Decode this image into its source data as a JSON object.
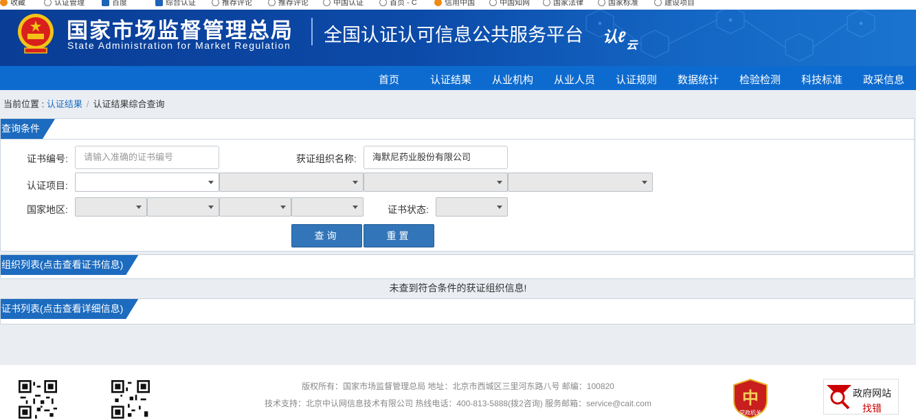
{
  "bookmarks": [
    "收藏",
    "认证管理",
    "百度",
    "综合认证",
    "推荐评论",
    "推荐评论",
    "中国认证",
    "首页 - C",
    "信用中国",
    "中国知网",
    "国家法律",
    "国家标准",
    "建设项目"
  ],
  "header": {
    "org_cn": "国家市场监督管理总局",
    "org_en": "State Administration  for  Market Regulation",
    "platform": "全国认证认可信息公共服务平台",
    "cloud_logo": "认",
    "cloud_logo_2": "云"
  },
  "nav": [
    "首页",
    "认证结果",
    "从业机构",
    "从业人员",
    "认证规则",
    "数据统计",
    "检验检测",
    "科技标准",
    "政采信息"
  ],
  "breadcrumb": {
    "prefix": "当前位置 : ",
    "link": "认证结果",
    "separator": "/",
    "current": "认证结果综合查询"
  },
  "query": {
    "panel_title": "查询条件",
    "cert_no_label": "证书编号:",
    "cert_no_placeholder": "请输入准确的证书编号",
    "org_name_label": "获证组织名称:",
    "org_name_value": "海默尼药业股份有限公司",
    "project_label": "认证项目:",
    "region_label": "国家地区:",
    "status_label": "证书状态:",
    "search_button": "查询",
    "reset_button": "重置"
  },
  "org_list": {
    "panel_title": "组织列表(点击查看证书信息)",
    "empty_message": "未查到符合条件的获证组织信息!"
  },
  "cert_list": {
    "panel_title": "证书列表(点击查看详细信息)"
  },
  "footer": {
    "line1": "版权所有：国家市场监督管理总局    地址：北京市西城区三里河东路八号    邮编：100820",
    "line2": "技术支持：北京中认网信息技术有限公司    热线电话：400-813-5888(拨2咨询)    服务邮箱：service@cait.com",
    "badge_text": "党政机关",
    "gov_site_line1": "政府网站",
    "gov_site_line2": "找错"
  },
  "colors": {
    "header_blue": "#0a3d96",
    "nav_blue": "#0d6bcf",
    "panel_tab_blue": "#1c6bbf",
    "button_blue": "#3275b8"
  }
}
